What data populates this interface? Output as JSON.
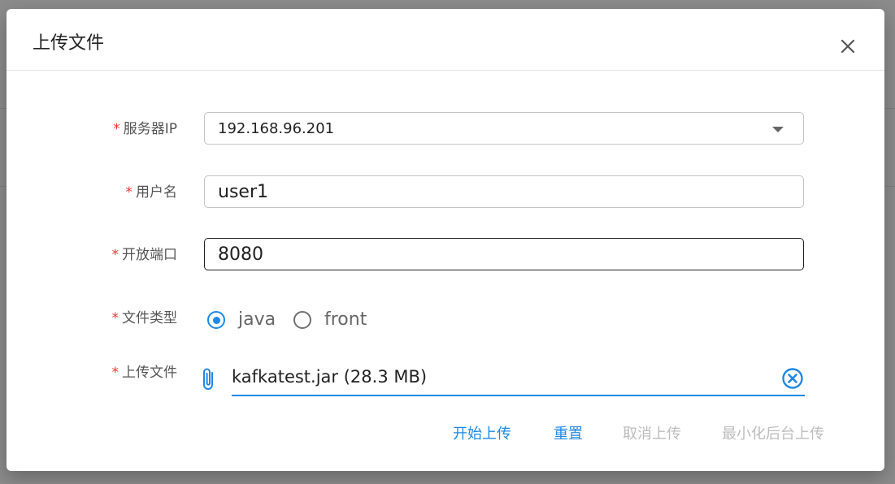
{
  "dialog": {
    "title": "上传文件",
    "close_icon": "close-icon"
  },
  "form": {
    "required_mark": "*",
    "server_ip": {
      "label": "服务器IP",
      "value": "192.168.96.201"
    },
    "username": {
      "label": "用户名",
      "value": "user1"
    },
    "port": {
      "label": "开放端口",
      "value": "8080"
    },
    "file_type": {
      "label": "文件类型",
      "options": [
        {
          "label": "java",
          "checked": true
        },
        {
          "label": "front",
          "checked": false
        }
      ]
    },
    "upload_file": {
      "label": "上传文件",
      "value": "kafkatest.jar (28.3 MB)",
      "icon": "paperclip-icon",
      "clear_icon": "clear-circle-icon"
    }
  },
  "actions": {
    "start_upload": "开始上传",
    "reset": "重置",
    "cancel_upload": "取消上传",
    "minimize_background": "最小化后台上传"
  },
  "colors": {
    "accent": "#1e88e5",
    "required": "#e53935",
    "disabled": "#bdbdbd"
  }
}
